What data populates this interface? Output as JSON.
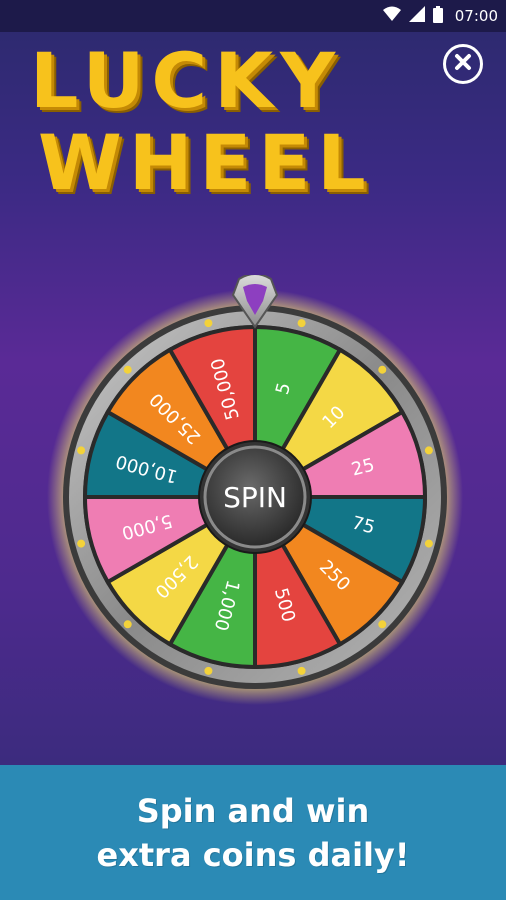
{
  "status_bar": {
    "time": "07:00",
    "icons": [
      "wifi-icon",
      "signal-icon",
      "battery-icon"
    ]
  },
  "header": {
    "title_line1": "LUCKY",
    "title_line2": "WHEEL",
    "close_icon": "close-icon",
    "title_color": "#f7c21c"
  },
  "wheel": {
    "center_label": "SPIN",
    "segments": [
      {
        "label": "5",
        "color": "#45b545"
      },
      {
        "label": "10",
        "color": "#f4d845"
      },
      {
        "label": "25",
        "color": "#ef7db3"
      },
      {
        "label": "75",
        "color": "#127688"
      },
      {
        "label": "250",
        "color": "#f2871f"
      },
      {
        "label": "500",
        "color": "#e4443f"
      },
      {
        "label": "1,000",
        "color": "#45b545"
      },
      {
        "label": "2,500",
        "color": "#f4d845"
      },
      {
        "label": "5,000",
        "color": "#ef7db3"
      },
      {
        "label": "10,000",
        "color": "#127688"
      },
      {
        "label": "25,000",
        "color": "#f2871f"
      },
      {
        "label": "50,000",
        "color": "#e4443f"
      }
    ]
  },
  "banner": {
    "line1": "Spin and win",
    "line2": "extra coins daily!",
    "background": "#2b8ab5"
  }
}
